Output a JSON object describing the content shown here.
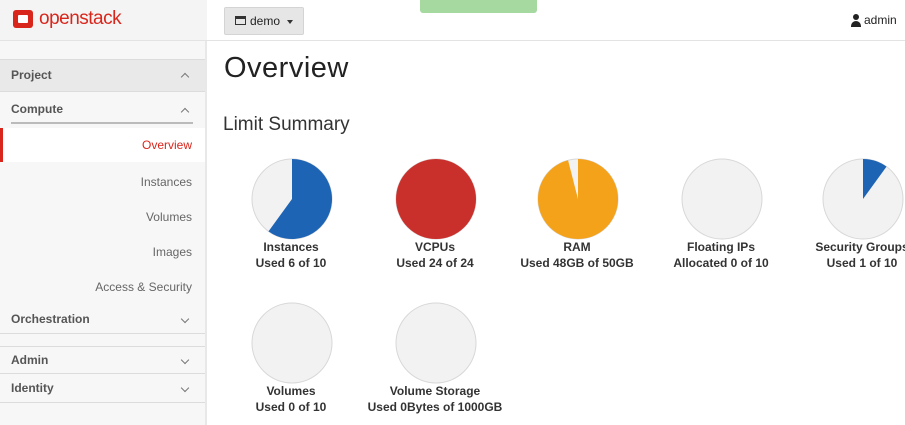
{
  "header": {
    "brand": "openstack",
    "project_label": "demo",
    "user_label": "admin"
  },
  "sidebar": {
    "project": "Project",
    "compute": "Compute",
    "items": [
      "Overview",
      "Instances",
      "Volumes",
      "Images",
      "Access & Security"
    ],
    "orchestration": "Orchestration",
    "admin": "Admin",
    "identity": "Identity"
  },
  "main": {
    "title": "Overview",
    "limit_summary": "Limit Summary"
  },
  "colors": {
    "brand_red": "#d9261c",
    "pie_background": "#f2f2f2",
    "pie_normal": "#1e64b4",
    "pie_full": "#c9302c",
    "pie_warning": "#f5a21b"
  },
  "limits": [
    {
      "title": "Instances",
      "text": "Used 6 of 10",
      "used": 6,
      "total": 10,
      "color": "#1e64b4"
    },
    {
      "title": "VCPUs",
      "text": "Used 24 of 24",
      "used": 24,
      "total": 24,
      "color": "#c9302c"
    },
    {
      "title": "RAM",
      "text": "Used 48GB of 50GB",
      "used": 48,
      "total": 50,
      "color": "#f5a21b"
    },
    {
      "title": "Floating IPs",
      "text": "Allocated 0 of 10",
      "used": 0,
      "total": 10,
      "color": "#1e64b4"
    },
    {
      "title": "Security Groups",
      "text": "Used 1 of 10",
      "used": 1,
      "total": 10,
      "color": "#1e64b4"
    },
    {
      "title": "Volumes",
      "text": "Used 0 of 10",
      "used": 0,
      "total": 10,
      "color": "#1e64b4"
    },
    {
      "title": "Volume Storage",
      "text": "Used 0Bytes of 1000GB",
      "used": 0,
      "total": 1000,
      "color": "#1e64b4"
    }
  ]
}
